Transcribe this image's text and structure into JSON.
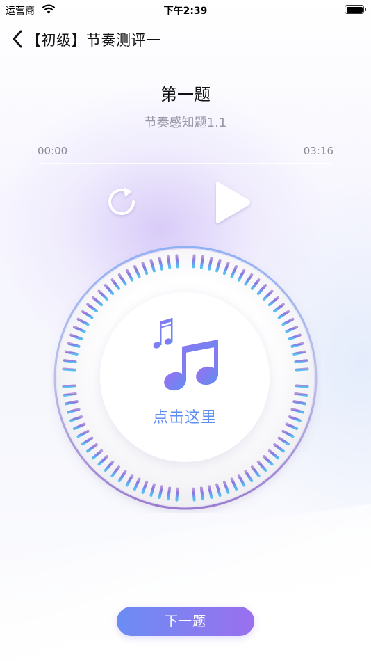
{
  "status_bar": {
    "carrier": "运营商",
    "time": "下午2:39"
  },
  "nav": {
    "title": "【初级】节奏测评一"
  },
  "question": {
    "title": "第一题",
    "subtitle": "节奏感知题1.1"
  },
  "player": {
    "current_time": "00:00",
    "total_time": "03:16",
    "progress": 0.0
  },
  "dial": {
    "tap_label": "点击这里"
  },
  "footer": {
    "next_label": "下一题"
  },
  "colors": {
    "accent_blue": "#5d8df2",
    "accent_purple": "#9a70ee"
  }
}
